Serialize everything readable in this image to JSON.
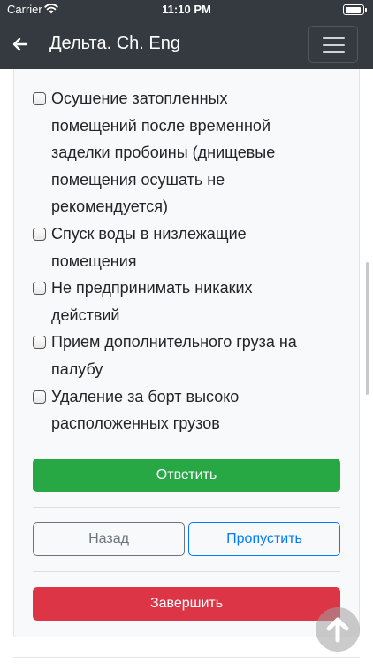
{
  "status_bar": {
    "carrier": "Carrier",
    "time": "11:10 PM"
  },
  "navbar": {
    "title": "Дельта. Ch. Eng"
  },
  "options": [
    {
      "label": "Осушение затопленных помещений после временной заделки пробоины (днищевые помещения осушать не рекомендуется)",
      "checked": false
    },
    {
      "label": "Спуск воды в низлежащие помещения",
      "checked": false
    },
    {
      "label": "Не предпринимать никаких действий",
      "checked": false
    },
    {
      "label": "Прием дополнительного груза на палубу",
      "checked": false
    },
    {
      "label": "Удаление за борт высоко расположенных грузов",
      "checked": false
    }
  ],
  "buttons": {
    "answer": "Ответить",
    "back": "Назад",
    "skip": "Пропустить",
    "finish": "Завершить"
  },
  "colors": {
    "navbar": "#343a40",
    "answer": "#28a745",
    "skip": "#007bff",
    "back": "#6c757d",
    "finish": "#dc3545"
  },
  "icons": {
    "back": "arrow-left-icon",
    "menu": "hamburger-icon",
    "scroll_top": "arrow-up-icon",
    "wifi": "wifi-icon",
    "battery": "battery-icon"
  }
}
